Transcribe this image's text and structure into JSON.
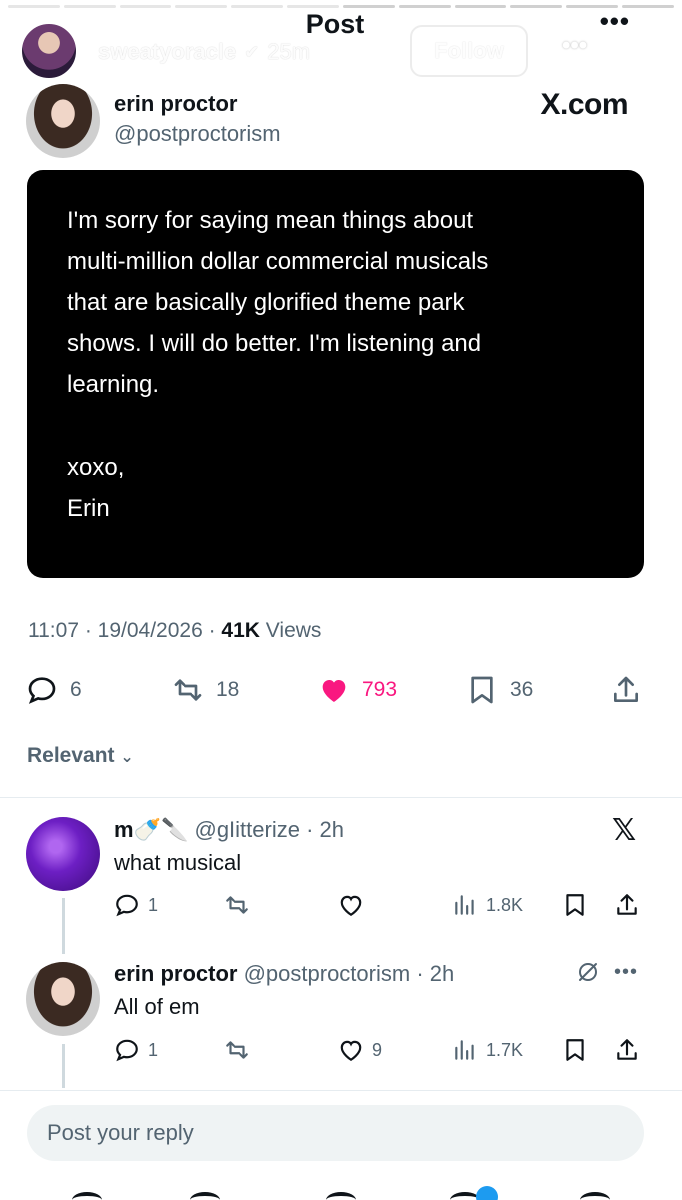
{
  "story": {
    "heading": "Post",
    "top_more": "•••",
    "user": "sweatyoracle",
    "time": "25m",
    "follow_label": "Follow",
    "more_label": "•••"
  },
  "post": {
    "author_name": "erin proctor",
    "author_handle": "@postproctorism",
    "brand": "X.com",
    "body": "I'm sorry for saying mean things about\nmulti-million dollar commercial musicals\nthat are basically glorified theme park\nshows. I will do better. I'm listening and\nlearning.",
    "sign_off": "xoxo,\nErin",
    "timestamp": "11:07 · 19/04/2026 · ",
    "views_count": "41K",
    "views_label": " Views",
    "replies": "6",
    "reposts": "18",
    "likes": "793",
    "bookmarks": "36"
  },
  "sort_label": "Relevant",
  "replies": [
    {
      "name": "m🍼🔪",
      "handle": "@gIitterize",
      "time": "· 2h",
      "text": "what musical",
      "reply_count": "1",
      "like_count": "",
      "views": "1.8K"
    },
    {
      "name": "erin proctor",
      "handle": "@postproctorism",
      "time": "· 2h",
      "text": "All of em",
      "reply_count": "1",
      "like_count": "9",
      "views": "1.7K"
    }
  ],
  "composer": {
    "placeholder": "Post your reply"
  },
  "colors": {
    "like": "#f91880",
    "muted": "#536471",
    "text": "#0f1419",
    "card_bg": "#000000"
  },
  "icons": [
    "back-arrow-icon",
    "verified-icon",
    "close-icon",
    "reply-icon",
    "repost-icon",
    "heart-icon",
    "bookmark-icon",
    "share-icon",
    "chevron-down-icon",
    "x-logo-icon",
    "views-icon",
    "grok-icon"
  ]
}
